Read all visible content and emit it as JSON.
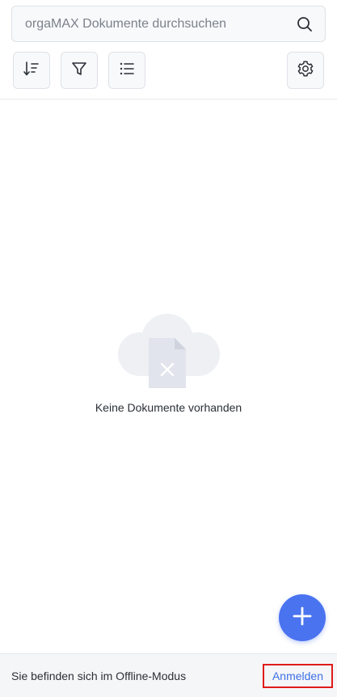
{
  "search": {
    "placeholder": "orgaMAX Dokumente durchsuchen",
    "value": "",
    "icon": "search-icon"
  },
  "toolbar": {
    "sort_icon": "sort-descending-icon",
    "filter_icon": "filter-icon",
    "list_icon": "list-view-icon",
    "settings_icon": "gear-icon"
  },
  "empty_state": {
    "icon": "cloud-document-x-icon",
    "text": "Keine Dokumente vorhanden"
  },
  "fab": {
    "icon": "plus-icon"
  },
  "footer": {
    "status_text": "Sie befinden sich im Offline-Modus",
    "login_label": "Anmelden"
  },
  "colors": {
    "accent": "#4a73f0",
    "link": "#3d6fe8",
    "highlight_border": "#e01b1b"
  }
}
